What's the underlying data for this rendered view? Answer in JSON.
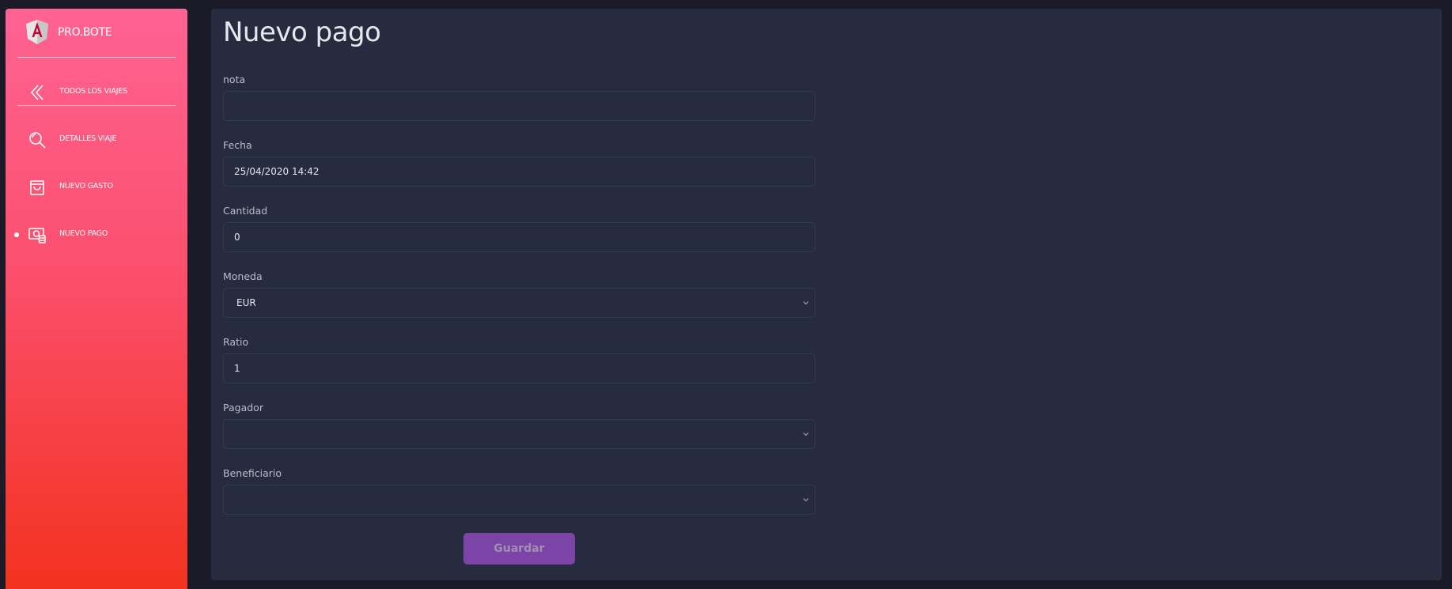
{
  "app": {
    "brand": "PRO.BOTE"
  },
  "sidebar": {
    "items": [
      {
        "label": "TODOS LOS VIAJES",
        "icon": "double-chevron-left-icon",
        "active": false
      },
      {
        "label": "DETALLES VIAJE",
        "icon": "magnifier-icon",
        "active": false
      },
      {
        "label": "NUEVO GASTO",
        "icon": "shopping-bag-icon",
        "active": false
      },
      {
        "label": "NUEVO PAGO",
        "icon": "money-icon",
        "active": true
      }
    ]
  },
  "form": {
    "title": "Nuevo pago",
    "nota": {
      "label": "nota",
      "value": ""
    },
    "fecha": {
      "label": "Fecha",
      "value": "25/04/2020 14:42"
    },
    "cantidad": {
      "label": "Cantidad",
      "value": "0"
    },
    "moneda": {
      "label": "Moneda",
      "value": "EUR"
    },
    "ratio": {
      "label": "Ratio",
      "value": "1"
    },
    "pagador": {
      "label": "Pagador",
      "value": ""
    },
    "beneficiario": {
      "label": "Beneficiario",
      "value": ""
    },
    "save_label": "Guardar"
  },
  "colors": {
    "sidebar_gradient_top": "#ff6393",
    "sidebar_gradient_bottom": "#f3321f",
    "panel_background": "#272b40",
    "page_background": "#1a1b27",
    "button": "#7b44a6"
  }
}
